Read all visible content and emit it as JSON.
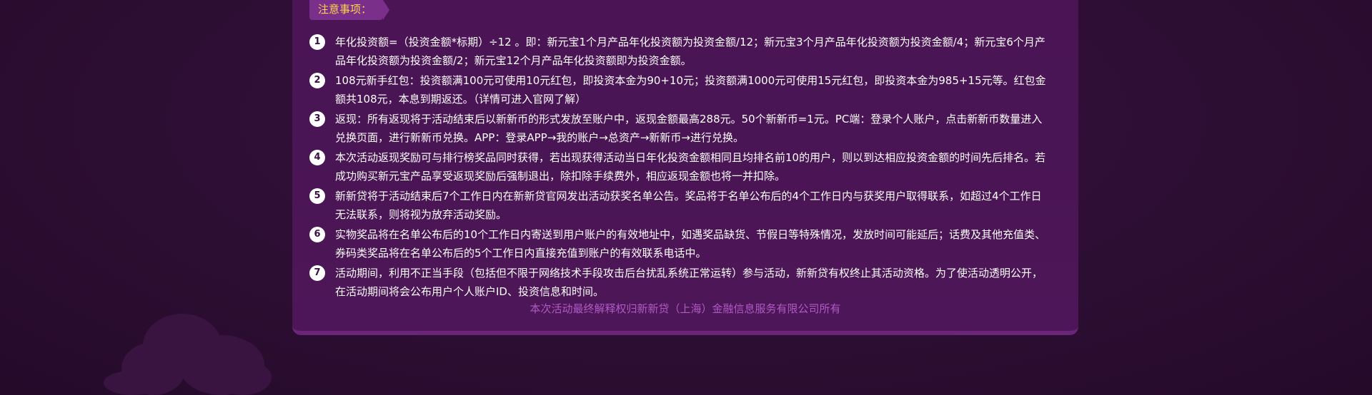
{
  "notice": {
    "tag_label": "注意事项：",
    "rules": [
      {
        "num": "1",
        "text": "年化投资额=（投资金额*标期）÷12 。即：新元宝1个月产品年化投资额为投资金额/12；新元宝3个月产品年化投资额为投资金额/4；新元宝6个月产品年化投资额为投资金额/2；新元宝12个月产品年化投资额即为投资金额。"
      },
      {
        "num": "2",
        "text": "108元新手红包：投资额满100元可使用10元红包，即投资本金为90+10元；投资额满1000元可使用15元红包，即投资本金为985+15元等。红包金额共108元，本息到期返还。（详情可进入官网了解）"
      },
      {
        "num": "3",
        "text": "返现：所有返现将于活动结束后以新新币的形式发放至账户中，返现金额最高288元。50个新新币=1元。PC端：登录个人账户，点击新新币数量进入兑换页面，进行新新币兑换。APP：登录APP→我的账户→总资产→新新币→进行兑换。"
      },
      {
        "num": "4",
        "text": "本次活动返现奖励可与排行榜奖品同时获得，若出现获得活动当日年化投资金额相同且均排名前10的用户，则以到达相应投资金额的时间先后排名。若成功购买新元宝产品享受返现奖励后强制退出，除扣除手续费外，相应返现金额也将一并扣除。"
      },
      {
        "num": "5",
        "text": "新新贷将于活动结束后7个工作日内在新新贷官网发出活动获奖名单公告。奖品将于名单公布后的4个工作日内与获奖用户取得联系，如超过4个工作日无法联系，则将视为放弃活动奖励。"
      },
      {
        "num": "6",
        "text": "实物奖品将在名单公布后的10个工作日内寄送到用户账户的有效地址中，如遇奖品缺货、节假日等特殊情况，发放时间可能延后；话费及其他充值类、券码类奖品将在名单公布后的5个工作日内直接充值到账户的有效联系电话中。"
      },
      {
        "num": "7",
        "text": "活动期间，利用不正当手段（包括但不限于网络技术手段攻击后台扰乱系统正常运转）参与活动，新新贷有权终止其活动资格。为了使活动透明公开，在活动期间将会公布用户个人账户ID、投资信息和时间。"
      }
    ],
    "footer": "本次活动最终解释权归新新贷（上海）金融信息服务有限公司所有"
  },
  "colors": {
    "background": "#2c0d31",
    "panel": "#4b1555",
    "tag_bg": "#7a2f8b",
    "tag_text": "#ffd64a",
    "footer_text": "#b05ac4"
  }
}
